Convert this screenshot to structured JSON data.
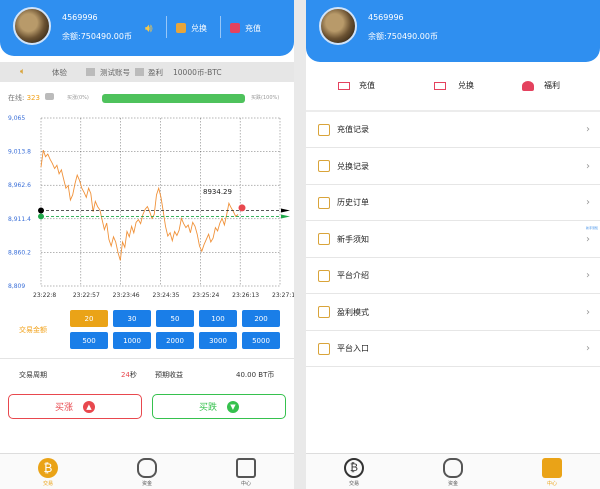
{
  "left": {
    "user": {
      "id": "4569996",
      "balance": "余额:750490.00币"
    },
    "header_buttons": {
      "exchange": "兑换",
      "recharge": "充值"
    },
    "info": {
      "demo": "体验",
      "account": "测试账号",
      "profit_label": "盈利",
      "profit_value": "10000币-BTC"
    },
    "online": {
      "label": "在线:",
      "count": "323"
    },
    "bar": {
      "left_label": "买涨(0%)",
      "right_label": "买跌(100%)"
    },
    "chart_data": {
      "type": "line",
      "y_ticks": [
        "9,065",
        "9,013.8",
        "8,962.6",
        "8,911.4",
        "8,860.2",
        "8,809"
      ],
      "x_ticks": [
        "23:22:8",
        "23:22:57",
        "23:23:46",
        "23:24:35",
        "23:25:24",
        "23:26:13",
        "23:27:1"
      ],
      "ylim": [
        8809,
        9065
      ],
      "values": [
        8990,
        9016,
        9006,
        9010,
        9002,
        8996,
        8988,
        8993,
        8980,
        8986,
        8972,
        8958,
        8962,
        8940,
        8948,
        8965,
        8978,
        8970,
        8958,
        8952,
        8944,
        8958,
        8950,
        8922,
        8938,
        8930,
        8925,
        8910,
        8895,
        8905,
        8880,
        8870,
        8884,
        8876,
        8860,
        8848,
        8876,
        8868,
        8892,
        8884,
        8900,
        8890,
        8906,
        8910,
        8904,
        8918,
        8926,
        8930,
        8922,
        8912,
        8918,
        8948,
        8958,
        8944,
        8922,
        8900,
        8885,
        8890,
        8878,
        8892,
        8886,
        8894,
        8912,
        8904,
        8898,
        8902,
        8890,
        8906,
        8900,
        8888,
        8870,
        8862,
        8872,
        8880,
        8888,
        8876,
        8882,
        8898,
        8893,
        8905,
        8912,
        8902,
        8918,
        8935,
        8928,
        8922,
        8915,
        8918
      ],
      "current_label": "8934.29",
      "current_value": 8925,
      "buy_line": 8924,
      "sell_line": 8915
    },
    "amount_label": "交易金额",
    "amounts": [
      "20",
      "30",
      "50",
      "100",
      "200",
      "500",
      "1000",
      "2000",
      "3000",
      "5000"
    ],
    "period": {
      "label": "交易周期",
      "value": "24",
      "unit": "秒",
      "expect_label": "预期收益",
      "expect_value": "40.00 BT币"
    },
    "buy_up": "买涨",
    "buy_down": "买跌",
    "tabs": [
      "交易",
      "资金",
      "中心"
    ]
  },
  "right": {
    "user": {
      "id": "4569996",
      "balance": "余额:750490.00币"
    },
    "quick": [
      "充值",
      "兑换",
      "福利"
    ],
    "menu": [
      "充值记录",
      "兑换记录",
      "历史订单",
      "新手须知",
      "平台介绍",
      "盈利模式",
      "平台入口"
    ],
    "badge": "新手须知",
    "tabs": [
      "交易",
      "资金",
      "中心"
    ]
  }
}
